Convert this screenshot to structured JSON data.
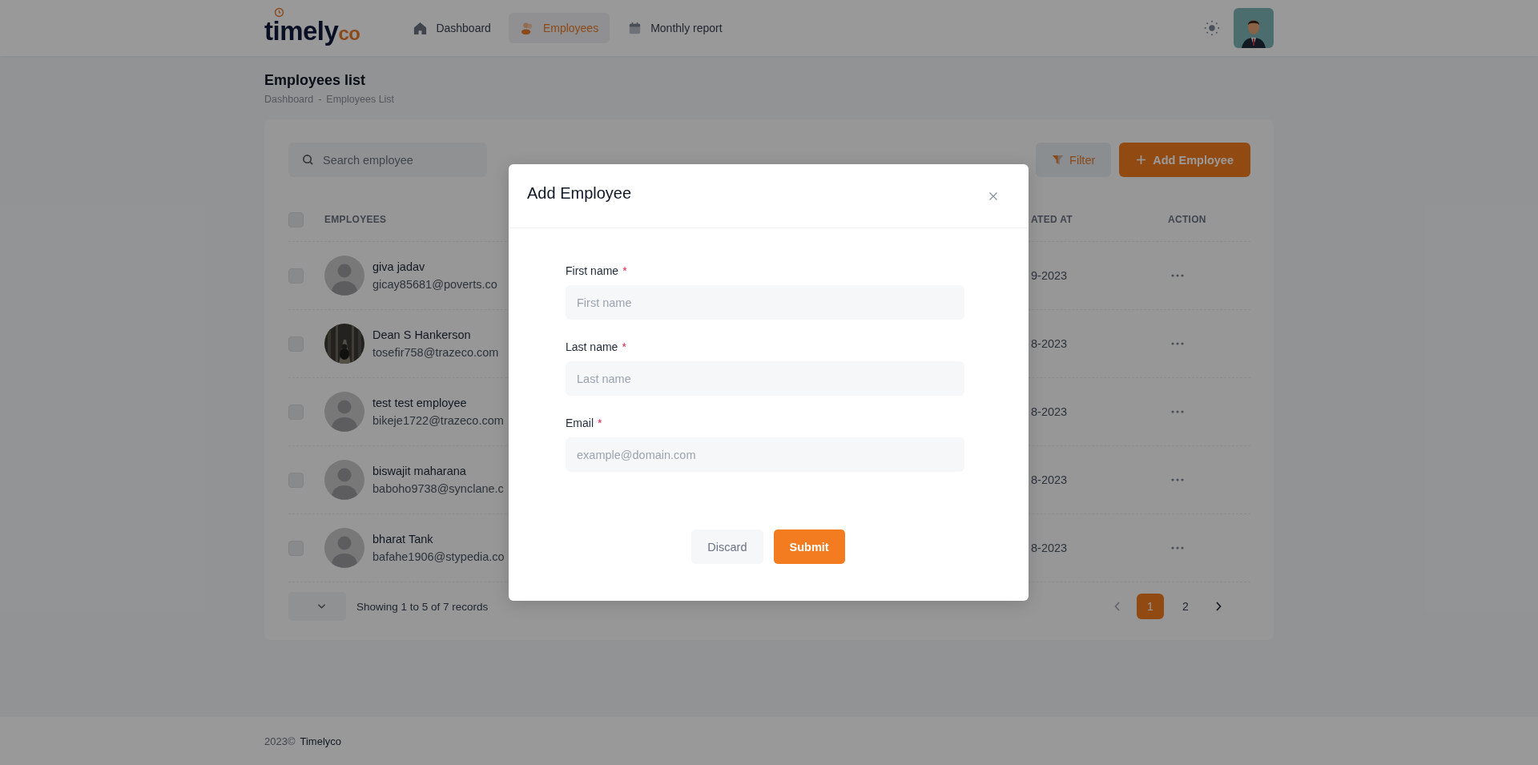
{
  "header": {
    "logo": {
      "text": "timely",
      "accent": "co"
    },
    "nav": [
      {
        "label": "Dashboard",
        "selected": false
      },
      {
        "label": "Employees",
        "selected": true
      },
      {
        "label": "Monthly report",
        "selected": false
      }
    ]
  },
  "page": {
    "title": "Employees list",
    "breadcrumb": [
      "Dashboard",
      "Employees List"
    ],
    "separator": "-"
  },
  "toolbar": {
    "search": {
      "placeholder": "Search employee"
    },
    "filter_button": "Filter",
    "add_button": "Add Employee"
  },
  "table": {
    "select_all": {
      "checked": false
    },
    "columns": [
      "EMPLOYEES",
      "ATED AT",
      "ACTION"
    ],
    "rows": [
      {
        "name": "giva jadav",
        "email": "gicay85681@poverts.co",
        "date": "9-2023",
        "kind": "default",
        "checked": false
      },
      {
        "name": "Dean S Hankerson",
        "email": "tosefir758@trazeco.com",
        "date": "8-2023",
        "checked": false
      },
      {
        "name": "test test employee",
        "email": "bikeje1722@trazeco.com",
        "date": "8-2023",
        "kind": "default",
        "checked": false
      },
      {
        "name": "biswajit maharana",
        "email": "baboho9738@synclane.c",
        "date": "8-2023",
        "kind": "default",
        "checked": false
      },
      {
        "name": "bharat Tank",
        "email": "bafahe1906@stypedia.co",
        "date": "8-2023",
        "kind": "default",
        "checked": false
      }
    ]
  },
  "table_footer": {
    "summary": "Showing 1 to 5 of 7 records",
    "pages": [
      {
        "label": "1",
        "selected": true
      },
      {
        "label": "2",
        "selected": false
      }
    ]
  },
  "modal": {
    "title": "Add Employee",
    "fields": [
      {
        "label": "First name",
        "required_mark": "*",
        "placeholder": "First name"
      },
      {
        "label": "Last name",
        "required_mark": "*",
        "placeholder": "Last name"
      },
      {
        "label": "Email",
        "required_mark": "*",
        "placeholder": "example@domain.com"
      }
    ],
    "buttons": [
      {
        "label": "Discard",
        "kind": "secondary"
      },
      {
        "label": "Submit",
        "kind": "primary"
      }
    ]
  },
  "footer": {
    "year": "2023©",
    "brand": "Timelyco"
  }
}
